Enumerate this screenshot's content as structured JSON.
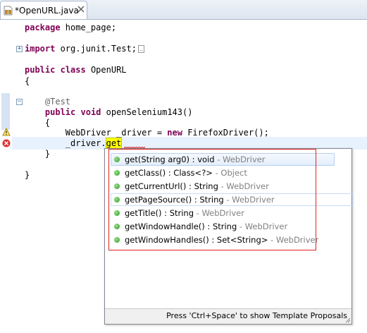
{
  "tab": {
    "title": "*OpenURL.java",
    "icon": "java-file-icon",
    "close_icon": "close-icon"
  },
  "code": {
    "line1_kw": "package",
    "line1_rest": " home_page;",
    "line2_kw": "import",
    "line2_rest": " org.junit.Test;",
    "line3_kw1": "public",
    "line3_kw2": "class",
    "line3_rest": " OpenURL",
    "line4": "{",
    "line5_ann": "@Test",
    "line6_kw1": "public",
    "line6_kw2": "void",
    "line6_rest": " openSelenium143()",
    "line7": "{",
    "line8_pre": "WebDriver _driver = ",
    "line8_kw": "new",
    "line8_post": " FirefoxDriver();",
    "line9_pre": "_driver.",
    "line9_get": "get",
    "line10": "}",
    "line11": "}"
  },
  "popup": {
    "proposals": [
      {
        "sig": "get(String arg0) : void",
        "owner": " - WebDriver"
      },
      {
        "sig": "getClass() : Class<?>",
        "owner": " - Object"
      },
      {
        "sig": "getCurrentUrl() : String",
        "owner": " - WebDriver"
      },
      {
        "sig": "getPageSource() : String",
        "owner": " - WebDriver"
      },
      {
        "sig": "getTitle() : String",
        "owner": " - WebDriver"
      },
      {
        "sig": "getWindowHandle() : String",
        "owner": " - WebDriver"
      },
      {
        "sig": "getWindowHandles() : Set<String>",
        "owner": " - WebDriver"
      }
    ],
    "footer": "Press 'Ctrl+Space' to show Template Proposals"
  },
  "colors": {
    "keyword": "#7f0055",
    "annotation": "#646464",
    "highlight": "#ffff00",
    "annotation_box": "#e02020"
  }
}
